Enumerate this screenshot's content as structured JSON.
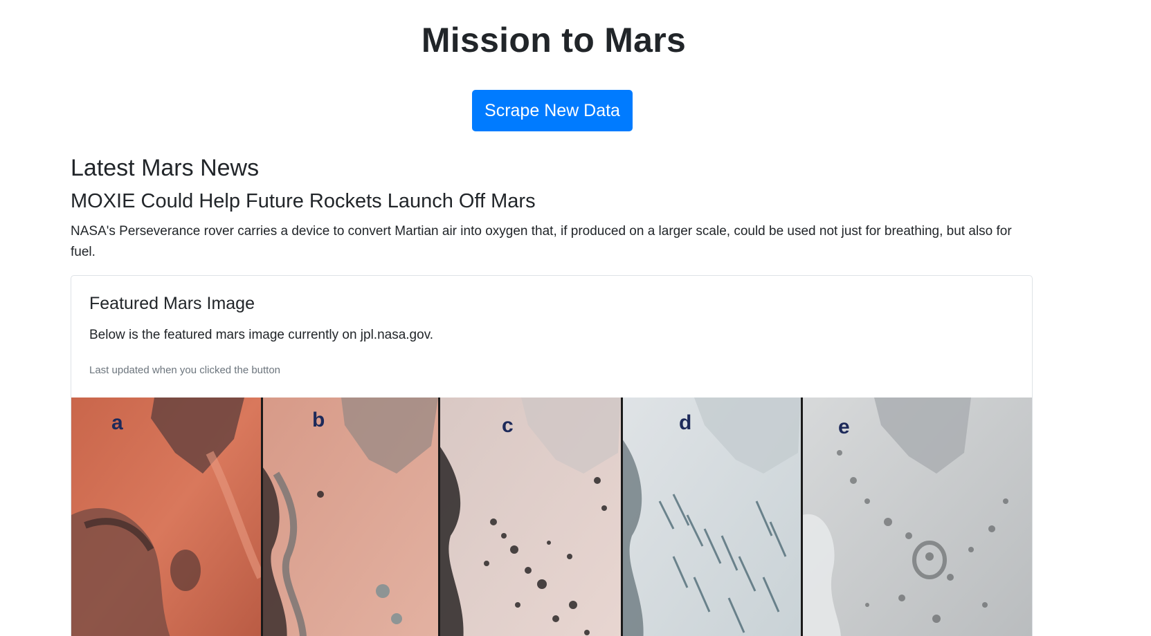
{
  "page": {
    "title": "Mission to Mars",
    "scrape_button_label": "Scrape New Data"
  },
  "news": {
    "section_heading": "Latest Mars News",
    "title": "MOXIE Could Help Future Rockets Launch Off Mars",
    "teaser": "NASA's Perseverance rover carries a device to convert Martian air into oxygen that, if produced on a larger scale, could be used not just for breathing, but also for fuel."
  },
  "featured_image": {
    "card_title": "Featured Mars Image",
    "card_text": "Below is the featured mars image currently on jpl.nasa.gov.",
    "card_muted": "Last updated when you clicked the button",
    "panel_labels": [
      "a",
      "b",
      "c",
      "d",
      "e"
    ]
  },
  "colors": {
    "primary_button": "#007bff",
    "muted_text": "#6c757d",
    "card_border": "#dee2e6"
  }
}
